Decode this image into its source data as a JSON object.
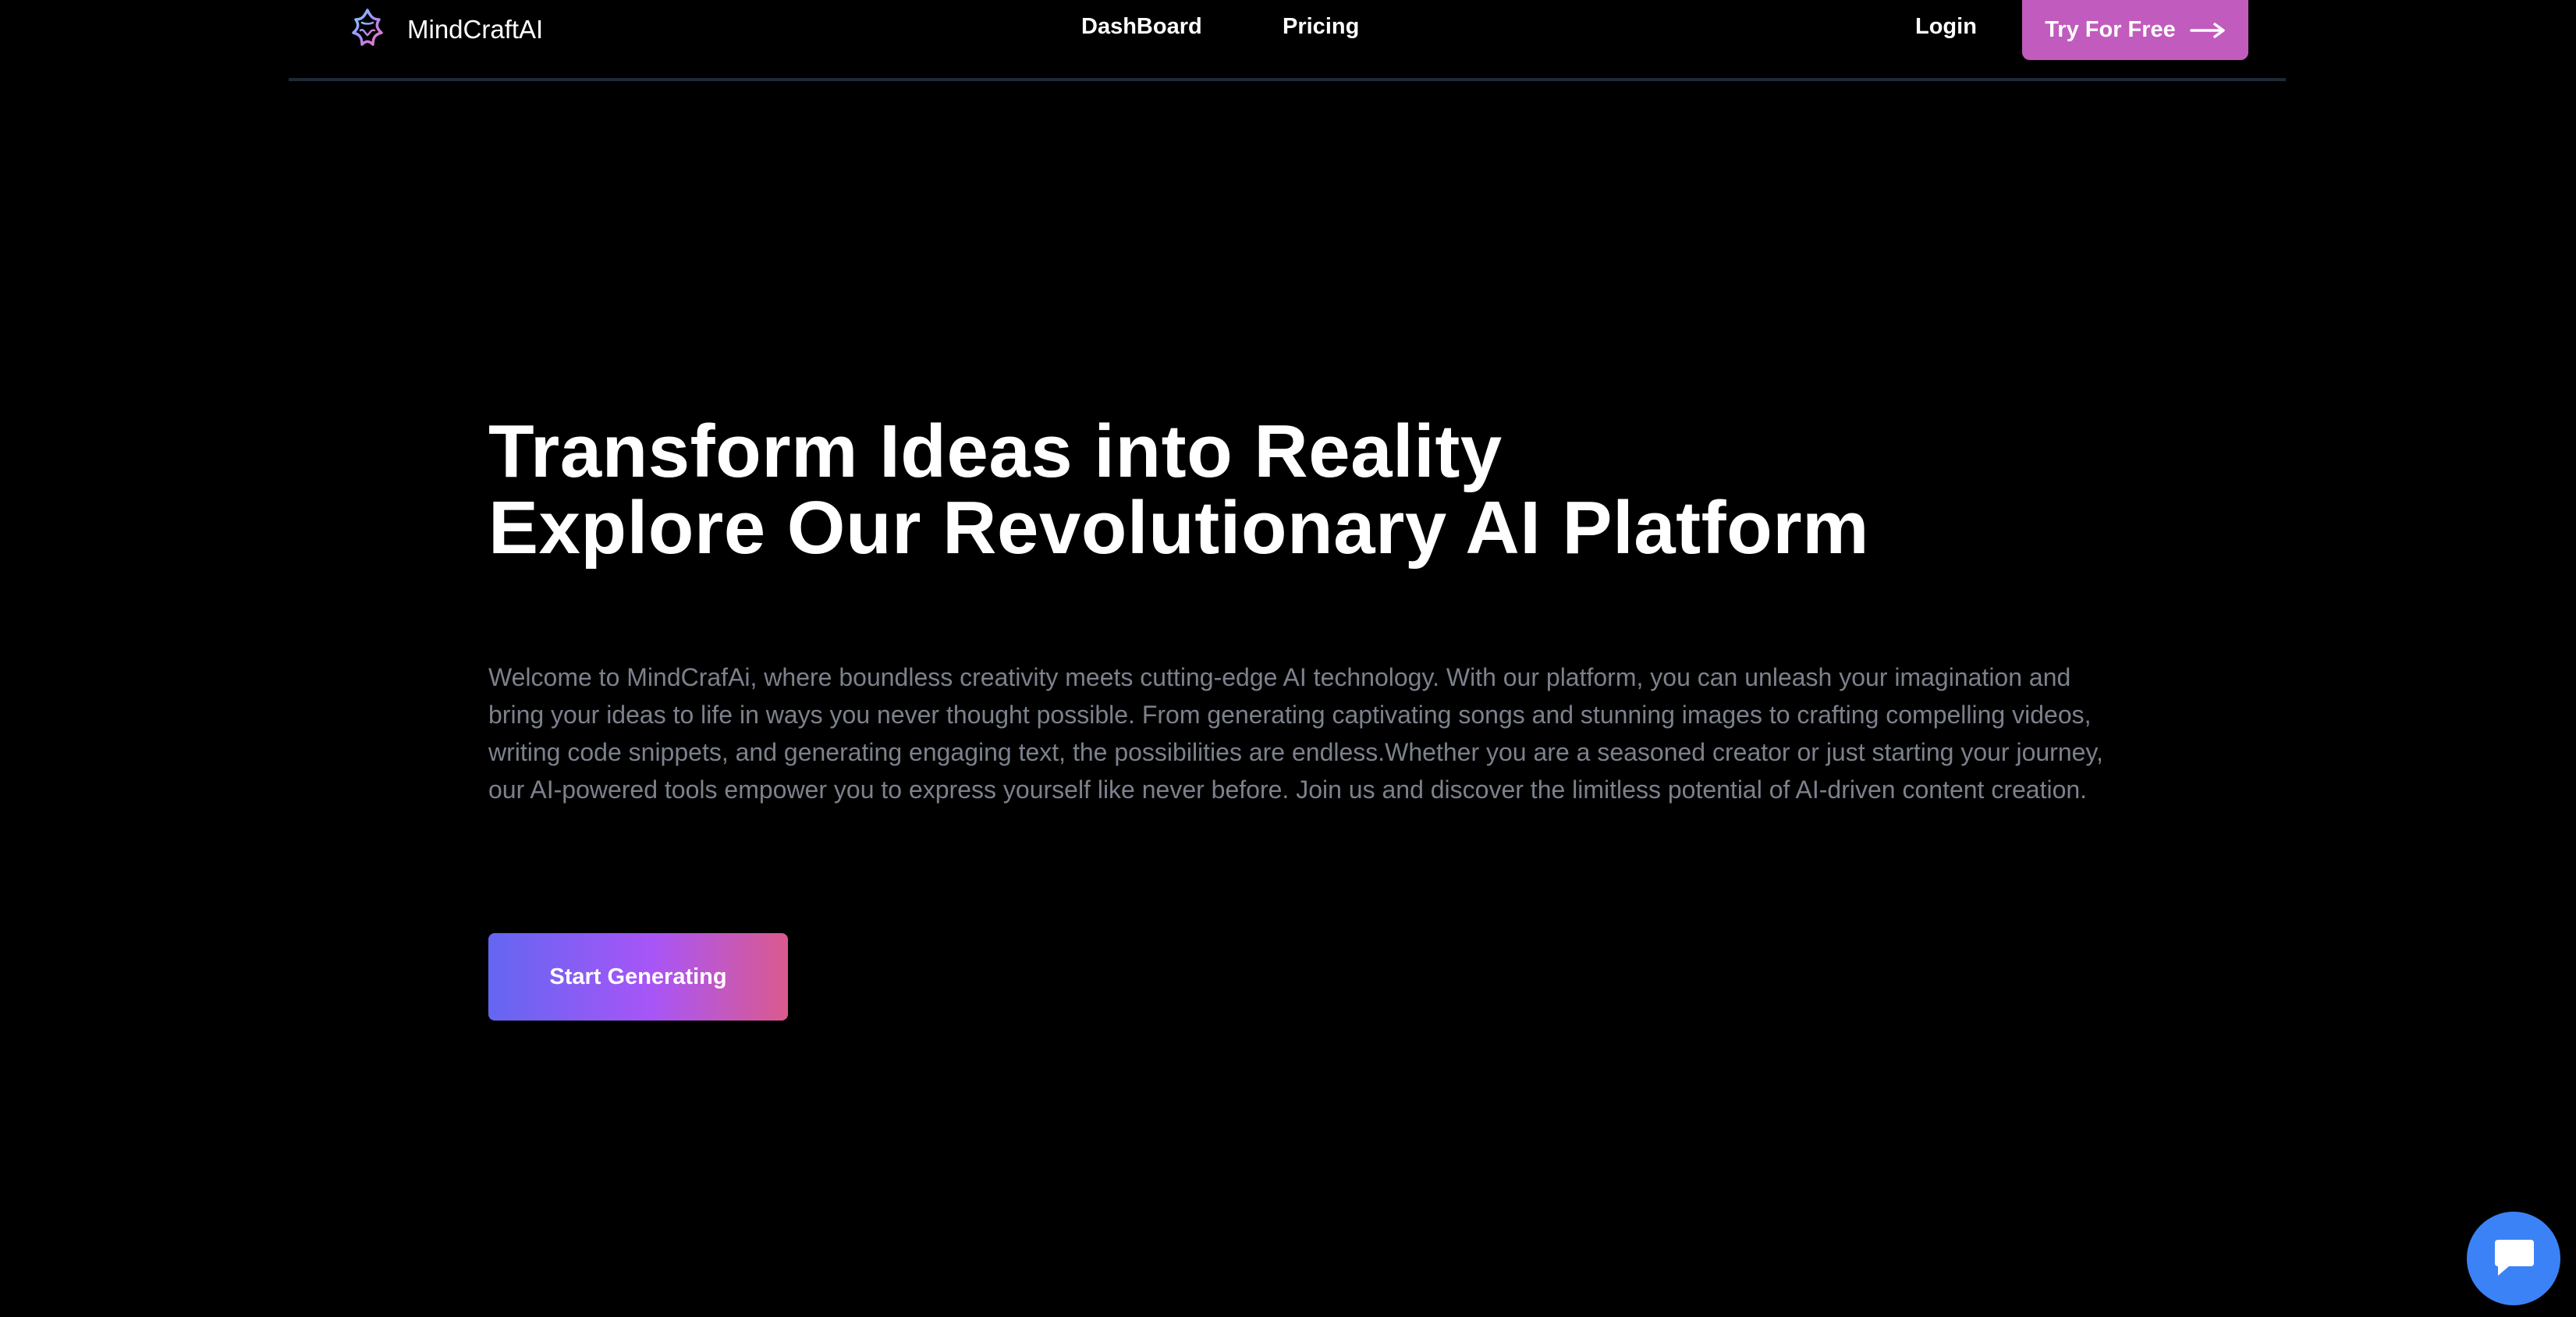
{
  "brand": {
    "name": "MindCraftAI",
    "logo_icon": "star-outline-icon"
  },
  "nav": {
    "dashboard": "DashBoard",
    "pricing": "Pricing",
    "login": "Login",
    "try_free": "Try For Free",
    "try_free_icon": "long-arrow-right-icon"
  },
  "hero": {
    "title_line1": "Transform Ideas into Reality",
    "title_line2": "Explore Our Revolutionary AI Platform",
    "description": "Welcome to MindCrafAi, where boundless creativity meets cutting-edge AI technology. With our platform, you can unleash your imagination and bring your ideas to life in ways you never thought possible. From generating captivating songs and stunning images to crafting compelling videos, writing code snippets, and generating engaging text, the possibilities are endless.Whether you are a seasoned creator or just starting your journey, our AI-powered tools empower you to express yourself like never before. Join us and discover the limitless potential of AI-driven content creation.",
    "cta": "Start Generating"
  },
  "chat": {
    "icon": "chat-bubble-icon"
  },
  "colors": {
    "background": "#000000",
    "accent_pink": "#c15bbd",
    "gradient_start": "#6366f1",
    "gradient_end": "#db5a8e",
    "chat_blue": "#3b82f6",
    "muted_text": "#7c818c"
  }
}
